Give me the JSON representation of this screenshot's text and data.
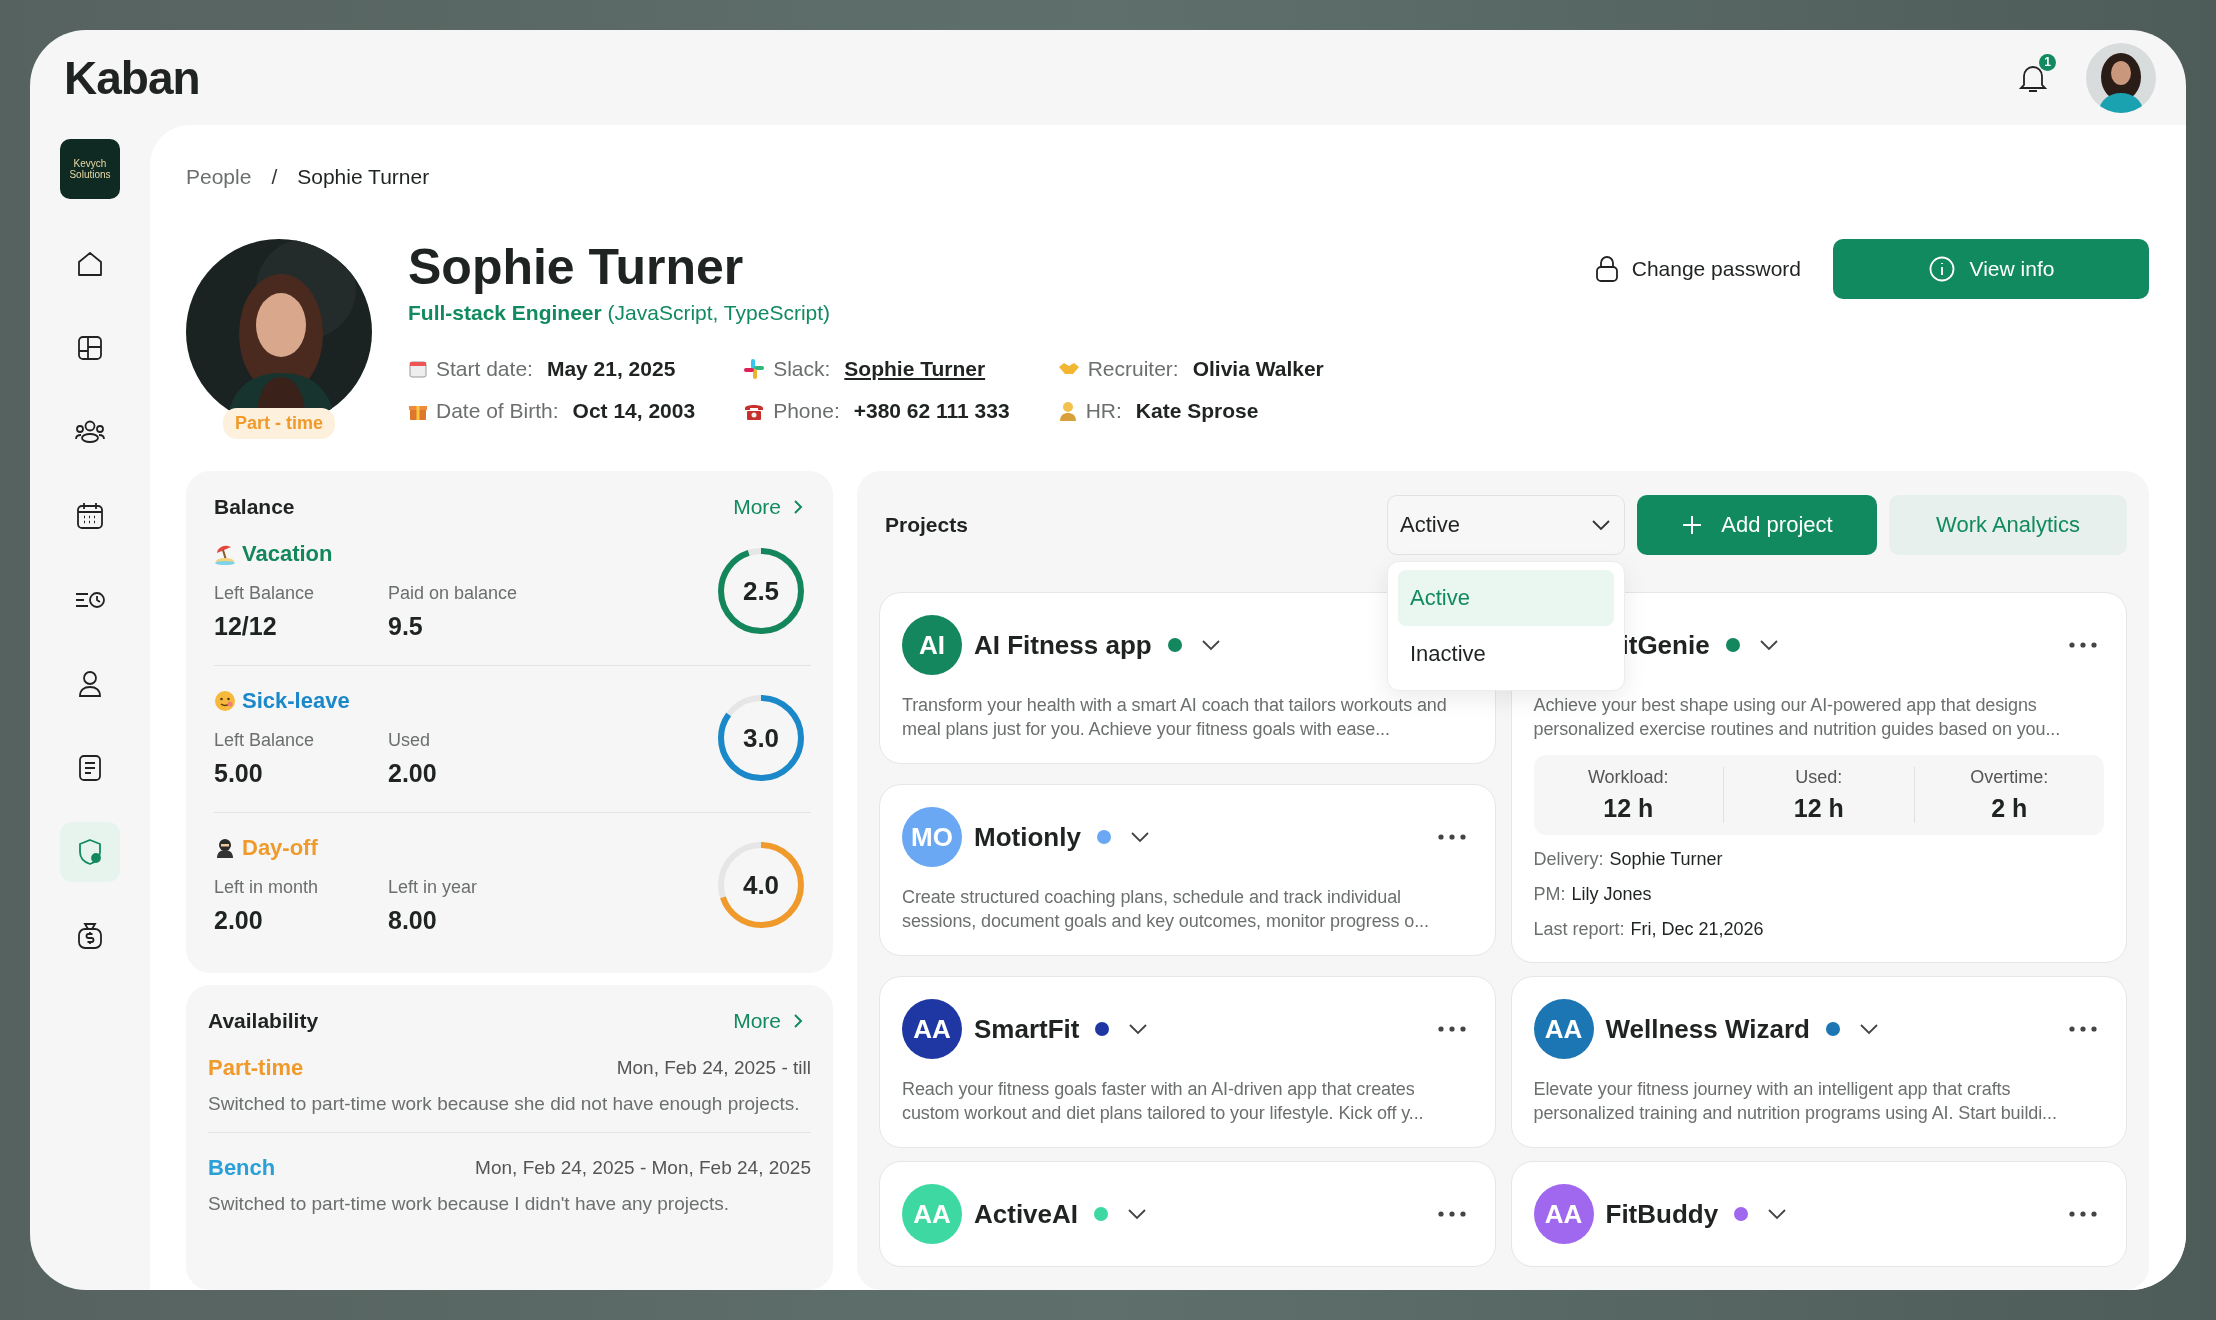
{
  "app": {
    "logo": "Kaban",
    "notifications": "1"
  },
  "sidebar": {
    "workspace": "Kevych Solutions",
    "items": [
      {
        "selected": false
      },
      {
        "selected": false
      },
      {
        "selected": false
      },
      {
        "selected": false
      },
      {
        "selected": false
      },
      {
        "selected": false
      },
      {
        "selected": false
      },
      {
        "selected": true
      },
      {
        "selected": false
      }
    ]
  },
  "breadcrumb": {
    "separator": "/",
    "items": [
      {
        "label": "People",
        "current": false
      },
      {
        "label": "Sophie Turner",
        "current": true
      }
    ]
  },
  "profile": {
    "name": "Sophie Turner",
    "role": "**Full-stack Engineer** (JavaScript, TypeScript)",
    "badge": "Part - time",
    "details": [
      {
        "label": "Start date:",
        "value": "May 21, 2025",
        "link": false
      },
      {
        "label": "Slack:",
        "value": "Sophie Turner",
        "link": true
      },
      {
        "label": "Recruiter:",
        "value": "Olivia Walker",
        "link": false
      },
      {
        "label": "Date of Birth:",
        "value": "Oct 14, 2003",
        "link": false
      },
      {
        "label": "Phone:",
        "value": "+380 62 111 333",
        "link": false
      },
      {
        "label": "HR:",
        "value": "Kate Sprose",
        "link": false
      }
    ],
    "change_password": "Change password",
    "view_info": "View info"
  },
  "balance": {
    "title": "Balance",
    "more": "More",
    "items": [
      {
        "name": "Vacation",
        "color": "#13875b",
        "stats": [
          {
            "label": "Left Balance",
            "value": "12/12"
          },
          {
            "label": "Paid on balance",
            "value": "9.5"
          }
        ],
        "reading": "2.5",
        "level": 0.95
      },
      {
        "name": "Sick-leave",
        "color": "#1a88c9",
        "stats": [
          {
            "label": "Left Balance",
            "value": "5.00"
          },
          {
            "label": "Used",
            "value": "2.00"
          }
        ],
        "reading": "3.0",
        "level": 0.85
      },
      {
        "name": "Day-off",
        "color": "#ef9a2b",
        "stats": [
          {
            "label": "Left in month",
            "value": "2.00"
          },
          {
            "label": "Left in year",
            "value": "8.00"
          }
        ],
        "reading": "4.0",
        "level": 0.7
      }
    ]
  },
  "availability": {
    "title": "Availability",
    "more": "More",
    "entries": [
      {
        "title": "Part-time",
        "color": "#ef9a2b",
        "dates": "Mon, Feb 24, 2025 - till",
        "note": "Switched to part-time work because she did not have enough projects."
      },
      {
        "title": "Bench",
        "color": "#2a9fd8",
        "dates": "Mon, Feb 24, 2025 - Mon, Feb 24, 2025",
        "note": "Switched to part-time work because I didn't have any projects."
      }
    ]
  },
  "projects": {
    "title": "Projects",
    "filter": {
      "value": "Active",
      "open": true,
      "options": [
        {
          "label": "Active",
          "selected": true
        },
        {
          "label": "Inactive",
          "selected": false
        }
      ]
    },
    "add_button": "Add project",
    "analytics_button": "Work Analytics",
    "cards": [
      {
        "initials": "AI",
        "name": "AI Fitness app",
        "color": "#14875e",
        "expanded": false,
        "more_button": false,
        "description": "Transform your health with a smart AI coach that tailors workouts and meal plans just for you. Achieve your fitness goals with ease..."
      },
      {
        "initials": "MO",
        "name": "Motionly",
        "color": "#6aa8f4",
        "expanded": false,
        "description": "Create structured coaching plans, schedule and track individual sessions, document goals and key outcomes, monitor progress o..."
      },
      {
        "name": "itGenie",
        "color": "#14875e",
        "expanded": true,
        "description": "Achieve your best shape using our AI-powered app that designs personalized exercise routines and nutrition guides based on you...",
        "stats": [
          {
            "label": "Workload:",
            "value": "12 h"
          },
          {
            "label": "Used:",
            "value": "12 h"
          },
          {
            "label": "Overtime:",
            "value": "2 h"
          }
        ],
        "details": [
          {
            "label": "Delivery:",
            "value": "Sophie Turner"
          },
          {
            "label": "PM:",
            "value": "Lily Jones"
          },
          {
            "label": "Last report:",
            "value": "Fri, Dec 21,2026"
          }
        ]
      },
      {
        "initials": "AA",
        "name": "SmartFit",
        "color": "#1f37a3",
        "expanded": false,
        "description": "Reach your fitness goals faster with an AI-driven app that creates custom workout and diet plans tailored to your lifestyle. Kick off y..."
      },
      {
        "initials": "AA",
        "name": "Wellness Wizard",
        "color": "#1b76b3",
        "expanded": false,
        "description": "Elevate your fitness journey with an intelligent app that crafts personalized training and nutrition programs using AI. Start buildi..."
      },
      {
        "initials": "AA",
        "name": "ActiveAI",
        "color": "#3ed8a3",
        "expanded": false
      },
      {
        "initials": "AA",
        "name": "FitBuddy",
        "color": "#a067ef",
        "expanded": false
      }
    ]
  }
}
